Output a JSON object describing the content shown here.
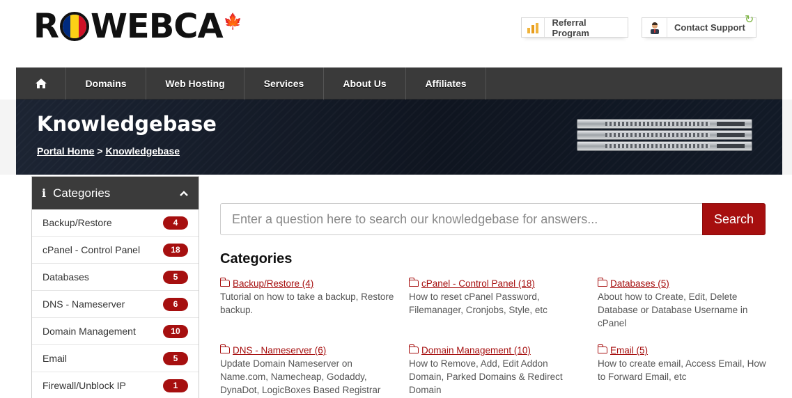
{
  "brand": {
    "logo_left": "R",
    "logo_right": "WEBCA",
    "flag_colors": [
      "#002b7f",
      "#fcd116",
      "#ce1126"
    ],
    "leaf": "🍁"
  },
  "top_buttons": {
    "referral": {
      "label": "Referral Program",
      "icon": "bar-chart-icon"
    },
    "support": {
      "label": "Contact Support",
      "icon": "support-agent-icon"
    }
  },
  "nav": {
    "home_icon": "⌂",
    "items": [
      "Domains",
      "Web Hosting",
      "Services",
      "About Us",
      "Affiliates"
    ]
  },
  "hero": {
    "title": "Knowledgebase",
    "breadcrumb": [
      "Portal Home",
      "Knowledgebase"
    ],
    "separator": ">"
  },
  "sidebar": {
    "info_icon": "i",
    "title": "Categories",
    "chevron": "^",
    "items": [
      {
        "label": "Backup/Restore",
        "count": "4"
      },
      {
        "label": "cPanel - Control Panel",
        "count": "18"
      },
      {
        "label": "Databases",
        "count": "5"
      },
      {
        "label": "DNS - Nameserver",
        "count": "6"
      },
      {
        "label": "Domain Management",
        "count": "10"
      },
      {
        "label": "Email",
        "count": "5"
      },
      {
        "label": "Firewall/Unblock IP",
        "count": "1"
      }
    ]
  },
  "search": {
    "placeholder": "Enter a question here to search our knowledgebase for answers...",
    "button": "Search"
  },
  "categories": {
    "title": "Categories",
    "items": [
      {
        "link": "Backup/Restore (4)",
        "desc": "Tutorial on how to take a backup, Restore backup."
      },
      {
        "link": "cPanel - Control Panel (18)",
        "desc": "How to reset cPanel Password, Filemanager, Cronjobs, Style, etc"
      },
      {
        "link": "Databases (5)",
        "desc": "About how to Create, Edit, Delete Database or Database Username in cPanel"
      },
      {
        "link": "DNS - Nameserver (6)",
        "desc": "Update Domain Nameserver on Name.com, Namecheap, Godaddy, DynaDot, LogicBoxes Based Registrar"
      },
      {
        "link": "Domain Management (10)",
        "desc": "How to Remove, Add, Edit Addon Domain, Parked Domains & Redirect Domain"
      },
      {
        "link": "Email (5)",
        "desc": "How to create email, Access Email, How to Forward Email, etc"
      }
    ]
  },
  "colors": {
    "accent": "#a60f0f",
    "nav_bg": "#3a3a3a",
    "hero_bg": "#151c28"
  }
}
